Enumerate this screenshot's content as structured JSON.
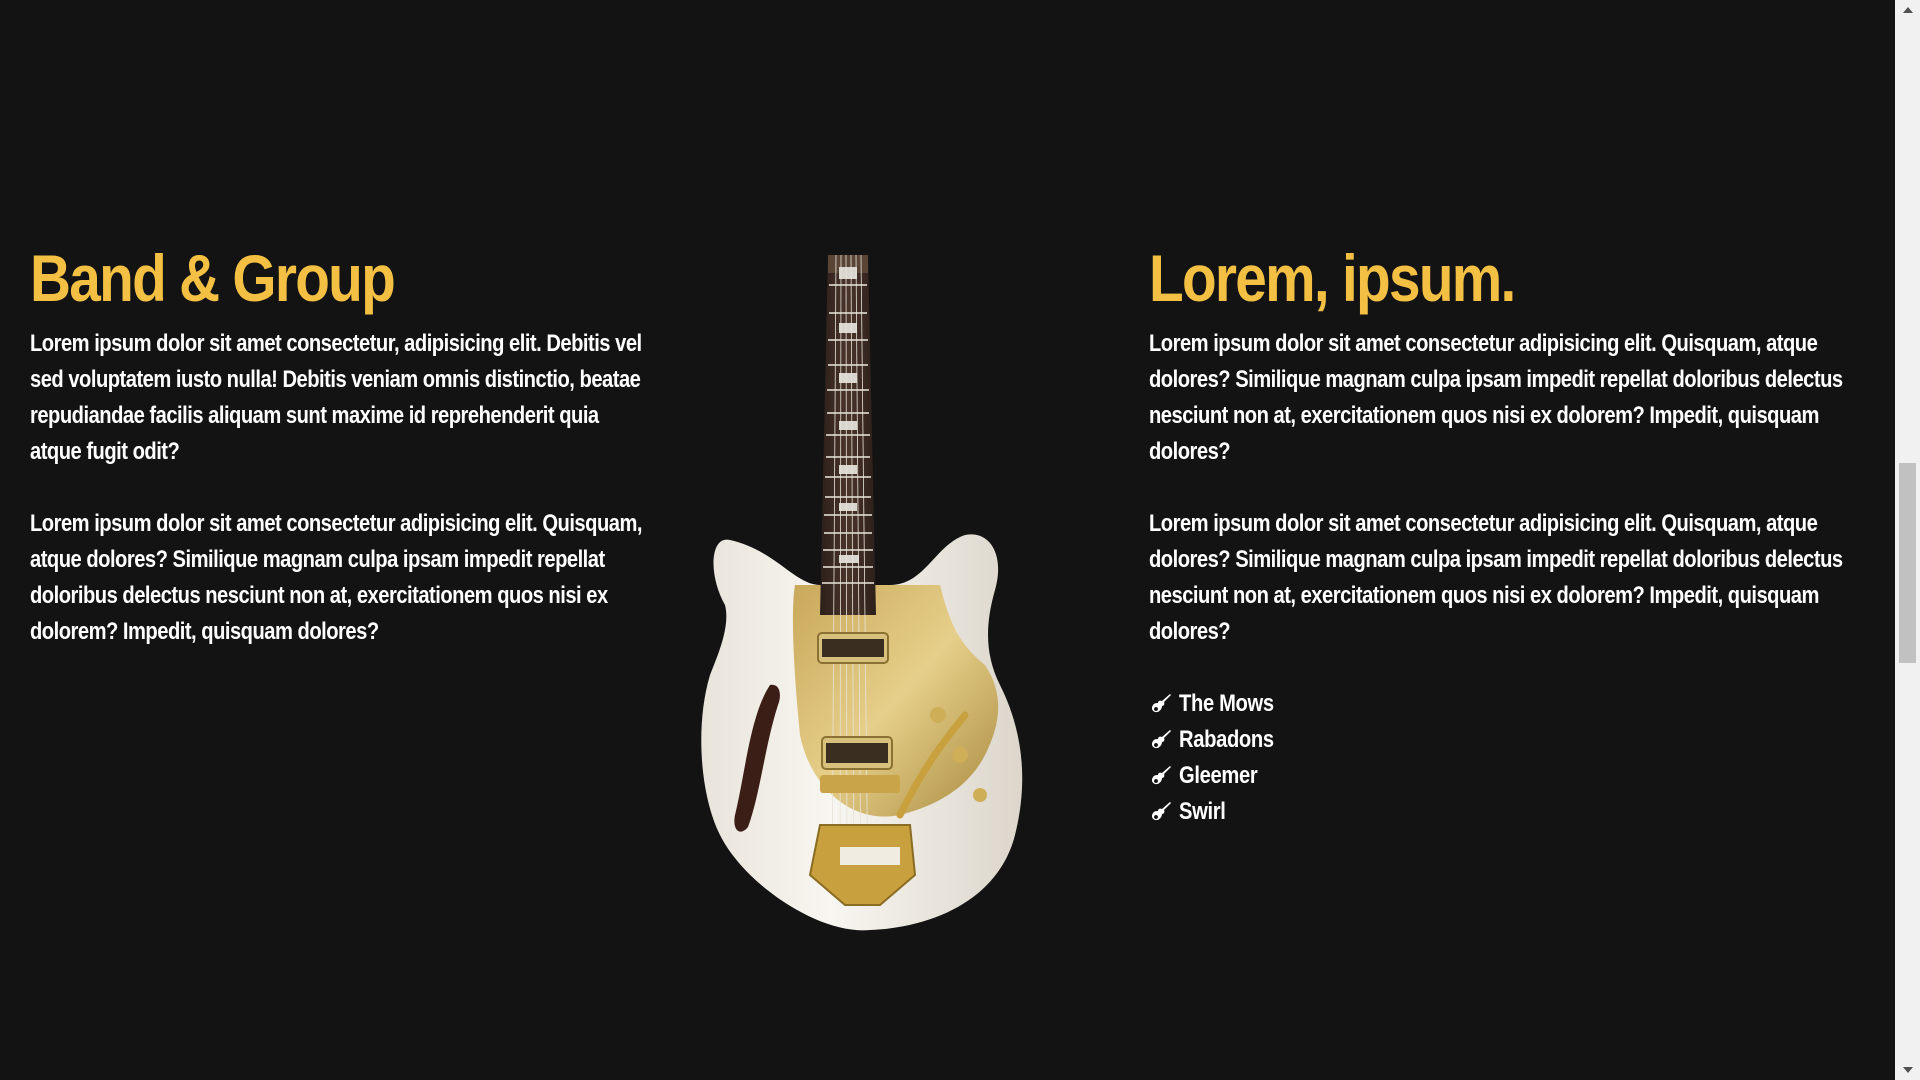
{
  "left_section": {
    "heading": "Band & Group",
    "paragraphs": [
      "Lorem ipsum dolor sit amet consectetur, adipisicing elit. Debitis vel sed voluptatem iusto nulla! Debitis veniam omnis distinctio, beatae repudiandae facilis aliquam sunt maxime id reprehenderit quia atque fugit odit?",
      "Lorem ipsum dolor sit amet consectetur adipisicing elit. Quisquam, atque dolores? Similique magnam culpa ipsam impedit repellat doloribus delectus nesciunt non at, exercitationem quos nisi ex dolorem? Impedit, quisquam dolores?"
    ]
  },
  "right_section": {
    "heading": "Lorem, ipsum.",
    "paragraphs": [
      "Lorem ipsum dolor sit amet consectetur adipisicing elit. Quisquam, atque dolores? Similique magnam culpa ipsam impedit repellat doloribus delectus nesciunt non at, exercitationem quos nisi ex dolorem? Impedit, quisquam dolores?",
      "Lorem ipsum dolor sit amet consectetur adipisicing elit. Quisquam, atque dolores? Similique magnam culpa ipsam impedit repellat doloribus delectus nesciunt non at, exercitationem quos nisi ex dolorem? Impedit, quisquam dolores?"
    ],
    "bands": [
      "The Mows",
      "Rabadons",
      "Gleemer",
      "Swirl"
    ],
    "band_icon": "guitar-icon"
  },
  "image": {
    "subject": "white-and-gold-electric-guitar"
  },
  "colors": {
    "background": "#131313",
    "accent": "#f3c043",
    "text": "#ffffff"
  }
}
